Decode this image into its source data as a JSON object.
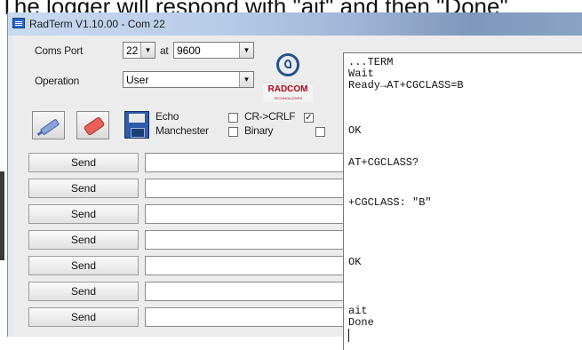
{
  "caption": {
    "text": "The logger will respond with \"ait\" and then \"Done\""
  },
  "window": {
    "title": "RadTerm V1.10.00 - Com 22"
  },
  "port": {
    "label": "Coms Port",
    "value": "22",
    "at_label": "at",
    "baud": "9600"
  },
  "operation": {
    "label": "Operation",
    "value": "User"
  },
  "logo": {
    "brand": "RADCOM",
    "tagline": "TECHNOLOGIES"
  },
  "options": {
    "echo": {
      "label": "Echo",
      "checked": false
    },
    "crlf": {
      "label": "CR->CRLF",
      "checked": true
    },
    "manchester": {
      "label": "Manchester",
      "checked": false
    },
    "binary": {
      "label": "Binary",
      "checked": false
    }
  },
  "send_rows": [
    {
      "label": "Send",
      "value": ""
    },
    {
      "label": "Send",
      "value": ""
    },
    {
      "label": "Send",
      "value": ""
    },
    {
      "label": "Send",
      "value": ""
    },
    {
      "label": "Send",
      "value": ""
    },
    {
      "label": "Send",
      "value": ""
    },
    {
      "label": "Send",
      "value": ""
    }
  ],
  "terminal": {
    "lines": [
      "...TERM",
      "Wait",
      "Ready→AT+CGCLASS=B",
      "OK",
      "AT+CGCLASS?",
      "+CGCLASS: \"B\"",
      "OK",
      "ait",
      "Done"
    ]
  },
  "icons": {
    "connect": "plug-icon",
    "clear": "eraser-icon",
    "save": "floppy-disk-icon"
  },
  "colors": {
    "brand_red": "#b40014",
    "logo_blue": "#26508f",
    "title_bar": "#b8cde8"
  }
}
